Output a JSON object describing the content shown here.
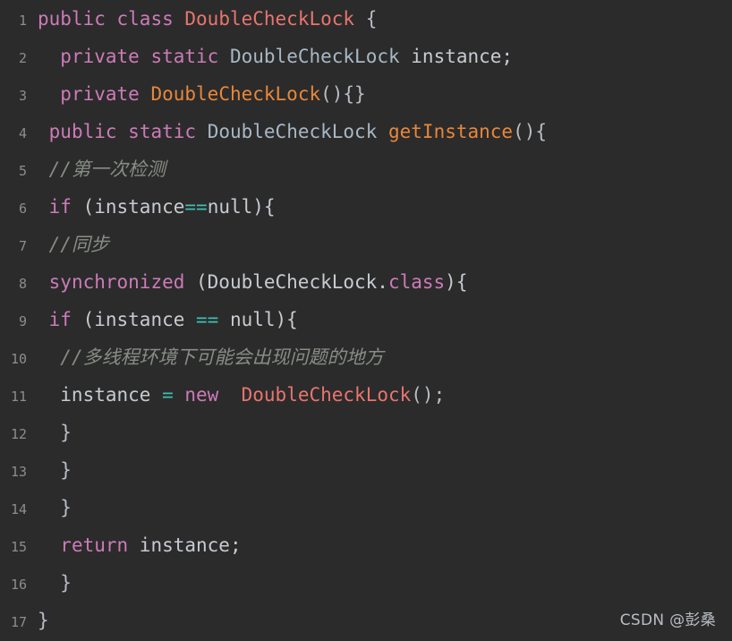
{
  "editor": {
    "language": "java",
    "background_color": "#2b2b2b",
    "theme": "dark",
    "line_count": 17,
    "gutter_color": "#8a8f8a",
    "colors": {
      "keyword": "#cc7bb8",
      "class_name": "#e8756f",
      "method_name": "#e8873a",
      "operator": "#3fbfb0",
      "comment": "#878d85",
      "plain_text": "#c7cbd1"
    },
    "line_numbers": [
      "1",
      "2",
      "3",
      "4",
      "5",
      "6",
      "7",
      "8",
      "9",
      "10",
      "11",
      "12",
      "13",
      "14",
      "15",
      "16",
      "17"
    ],
    "lines": [
      {
        "number": "1",
        "tokens": [
          {
            "t": "public",
            "c": "kw"
          },
          {
            "t": " ",
            "c": "plain"
          },
          {
            "t": "class",
            "c": "kw"
          },
          {
            "t": " ",
            "c": "plain"
          },
          {
            "t": "DoubleCheckLock",
            "c": "cls"
          },
          {
            "t": " {",
            "c": "punc"
          }
        ]
      },
      {
        "number": "2",
        "tokens": [
          {
            "t": "  ",
            "c": "plain"
          },
          {
            "t": "private",
            "c": "kw"
          },
          {
            "t": " ",
            "c": "plain"
          },
          {
            "t": "static",
            "c": "kw"
          },
          {
            "t": " ",
            "c": "plain"
          },
          {
            "t": "DoubleCheckLock",
            "c": "type"
          },
          {
            "t": " instance;",
            "c": "plain"
          }
        ]
      },
      {
        "number": "3",
        "tokens": [
          {
            "t": "  ",
            "c": "plain"
          },
          {
            "t": "private",
            "c": "kw"
          },
          {
            "t": " ",
            "c": "plain"
          },
          {
            "t": "DoubleCheckLock",
            "c": "method"
          },
          {
            "t": "(){}",
            "c": "punc"
          }
        ]
      },
      {
        "number": "4",
        "tokens": [
          {
            "t": " ",
            "c": "plain"
          },
          {
            "t": "public",
            "c": "kw"
          },
          {
            "t": " ",
            "c": "plain"
          },
          {
            "t": "static",
            "c": "kw"
          },
          {
            "t": " ",
            "c": "plain"
          },
          {
            "t": "DoubleCheckLock",
            "c": "type"
          },
          {
            "t": " ",
            "c": "plain"
          },
          {
            "t": "getInstance",
            "c": "method"
          },
          {
            "t": "(){",
            "c": "punc"
          }
        ]
      },
      {
        "number": "5",
        "tokens": [
          {
            "t": " ",
            "c": "plain"
          },
          {
            "t": "//第一次检测",
            "c": "comment"
          }
        ]
      },
      {
        "number": "6",
        "tokens": [
          {
            "t": " ",
            "c": "plain"
          },
          {
            "t": "if",
            "c": "kw"
          },
          {
            "t": " (instance",
            "c": "plain"
          },
          {
            "t": "==",
            "c": "op"
          },
          {
            "t": "null){",
            "c": "plain"
          }
        ]
      },
      {
        "number": "7",
        "tokens": [
          {
            "t": " ",
            "c": "plain"
          },
          {
            "t": "//同步",
            "c": "comment"
          }
        ]
      },
      {
        "number": "8",
        "tokens": [
          {
            "t": " ",
            "c": "plain"
          },
          {
            "t": "synchronized",
            "c": "kw"
          },
          {
            "t": " (DoubleCheckLock.",
            "c": "plain"
          },
          {
            "t": "class",
            "c": "kw"
          },
          {
            "t": "){",
            "c": "plain"
          }
        ]
      },
      {
        "number": "9",
        "tokens": [
          {
            "t": " ",
            "c": "plain"
          },
          {
            "t": "if",
            "c": "kw"
          },
          {
            "t": " (instance ",
            "c": "plain"
          },
          {
            "t": "==",
            "c": "op"
          },
          {
            "t": " null){",
            "c": "plain"
          }
        ]
      },
      {
        "number": "10",
        "tokens": [
          {
            "t": "  ",
            "c": "plain"
          },
          {
            "t": "//多线程环境下可能会出现问题的地方",
            "c": "comment"
          }
        ]
      },
      {
        "number": "11",
        "tokens": [
          {
            "t": "  instance ",
            "c": "plain"
          },
          {
            "t": "=",
            "c": "op"
          },
          {
            "t": " ",
            "c": "plain"
          },
          {
            "t": "new",
            "c": "kw"
          },
          {
            "t": "  ",
            "c": "plain"
          },
          {
            "t": "DoubleCheckLock",
            "c": "cls"
          },
          {
            "t": "();",
            "c": "punc"
          }
        ]
      },
      {
        "number": "12",
        "tokens": [
          {
            "t": "  }",
            "c": "punc"
          }
        ]
      },
      {
        "number": "13",
        "tokens": [
          {
            "t": "  }",
            "c": "punc"
          }
        ]
      },
      {
        "number": "14",
        "tokens": [
          {
            "t": "  }",
            "c": "punc"
          }
        ]
      },
      {
        "number": "15",
        "tokens": [
          {
            "t": "  ",
            "c": "plain"
          },
          {
            "t": "return",
            "c": "kw"
          },
          {
            "t": " instance;",
            "c": "plain"
          }
        ]
      },
      {
        "number": "16",
        "tokens": [
          {
            "t": "  }",
            "c": "punc"
          }
        ]
      },
      {
        "number": "17",
        "tokens": [
          {
            "t": "}",
            "c": "punc"
          }
        ]
      }
    ]
  },
  "watermark": {
    "text": "CSDN @彭桑"
  }
}
